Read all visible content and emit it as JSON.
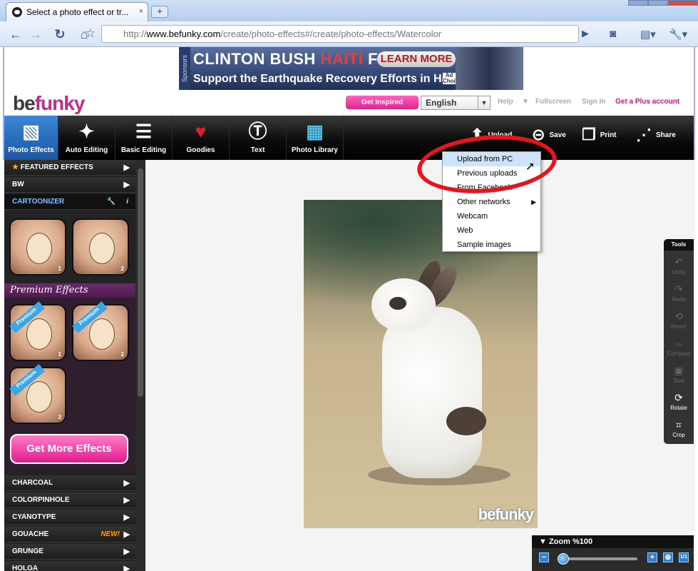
{
  "browser": {
    "tab_title": "Select a photo effect or tr...",
    "tab_close": "×",
    "new_tab": "+",
    "url_prefix": "http://",
    "url_domain": "www.befunky.com",
    "url_path": "/create/photo-effects#/create/photo-effects/Watercolor"
  },
  "banner": {
    "side_label": "Sponsors",
    "title_a": "CLINTON BUSH ",
    "title_haiti": "HAITI",
    "title_b": " FUND",
    "learn_more": "LEARN MORE",
    "subtitle": "Support the Earthquake Recovery Efforts in Haiti",
    "ad_choice": "Ad Choice"
  },
  "header": {
    "logo_be": "be",
    "logo_funky": "funky",
    "get_inspired": "Get Inspired",
    "language": "English",
    "help": "Help",
    "fullscreen": "Fullscreen",
    "sign_in": "Sign In",
    "plus": "Get a Plus account"
  },
  "tools": [
    {
      "label": "Photo Effects",
      "icon": "photos-icon"
    },
    {
      "label": "Auto Editing",
      "icon": "magic-wand-icon"
    },
    {
      "label": "Basic Editing",
      "icon": "sliders-icon"
    },
    {
      "label": "Goodies",
      "icon": "heart-icon"
    },
    {
      "label": "Text",
      "icon": "text-icon"
    },
    {
      "label": "Photo Library",
      "icon": "grid-icon"
    }
  ],
  "actions": {
    "upload": "Upload",
    "save": "Save",
    "print": "Print",
    "share": "Share"
  },
  "sidebar": {
    "featured": "FEATURED EFFECTS",
    "bw": "BW",
    "cartoonizer": "CARTOONIZER",
    "premium_effects": "Premium Effects",
    "premium_badge": "Premium",
    "get_more": "Get More Effects",
    "categories": [
      "CHARCOAL",
      "COLORPINHOLE",
      "CYANOTYPE",
      "GOUACHE",
      "GRUNGE",
      "HOLGA"
    ],
    "new_badge": "NEW!",
    "thumb_nums": [
      "1",
      "2",
      "1",
      "2",
      "3"
    ]
  },
  "upload_menu": [
    "Upload from PC",
    "Previous uploads",
    "From Facebook",
    "Other networks",
    "Webcam",
    "Web",
    "Sample images"
  ],
  "canvas": {
    "watermark": "befunky"
  },
  "rail": {
    "header": "Tools",
    "items": [
      "Undo",
      "Redo",
      "Reset",
      "Compare",
      "Size",
      "Rotate",
      "Crop"
    ]
  },
  "zoom": {
    "label": "Zoom %100",
    "level": 100,
    "minus": "−",
    "plus": "+",
    "fit": "1/1"
  }
}
